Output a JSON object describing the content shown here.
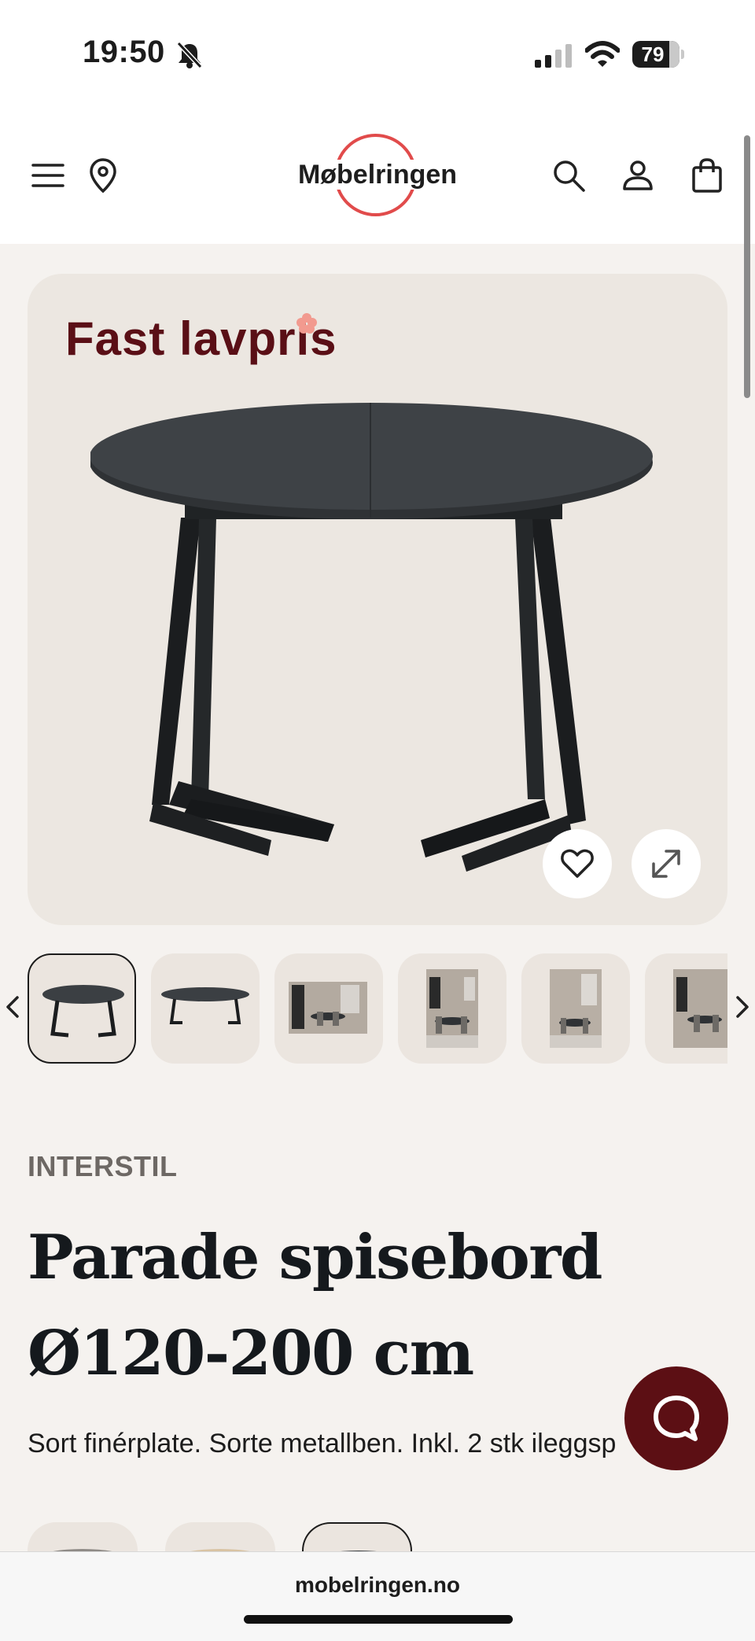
{
  "status_bar": {
    "time": "19:50",
    "battery": "79",
    "icons": [
      "bell-slash-icon",
      "cellular-signal-icon",
      "wifi-icon",
      "battery-icon"
    ]
  },
  "header": {
    "logo_text": "Møbelringen",
    "brand_color": "#e14b4b",
    "icons": [
      "menu-icon",
      "location-pin-icon",
      "search-icon",
      "user-icon",
      "shopping-bag-icon"
    ]
  },
  "product_image": {
    "badge": "Fast lavpris",
    "badge_color": "#5a0f16",
    "actions": [
      "heart-icon",
      "expand-icon"
    ]
  },
  "thumbnails": {
    "count": 6,
    "active_index": 0,
    "icons": [
      "chevron-left-icon",
      "chevron-right-icon"
    ]
  },
  "product": {
    "brand": "INTERSTIL",
    "title": "Parade spisebord Ø120-200 cm",
    "description": "Sort finérplate. Sorte metallben. Inkl. 2 stk ileggsp"
  },
  "variants": {
    "count": 3,
    "selected_index": 2
  },
  "chat": {
    "icon": "chat-bubble-icon",
    "color": "#5c0f14"
  },
  "browser": {
    "url": "mobelringen.no"
  }
}
